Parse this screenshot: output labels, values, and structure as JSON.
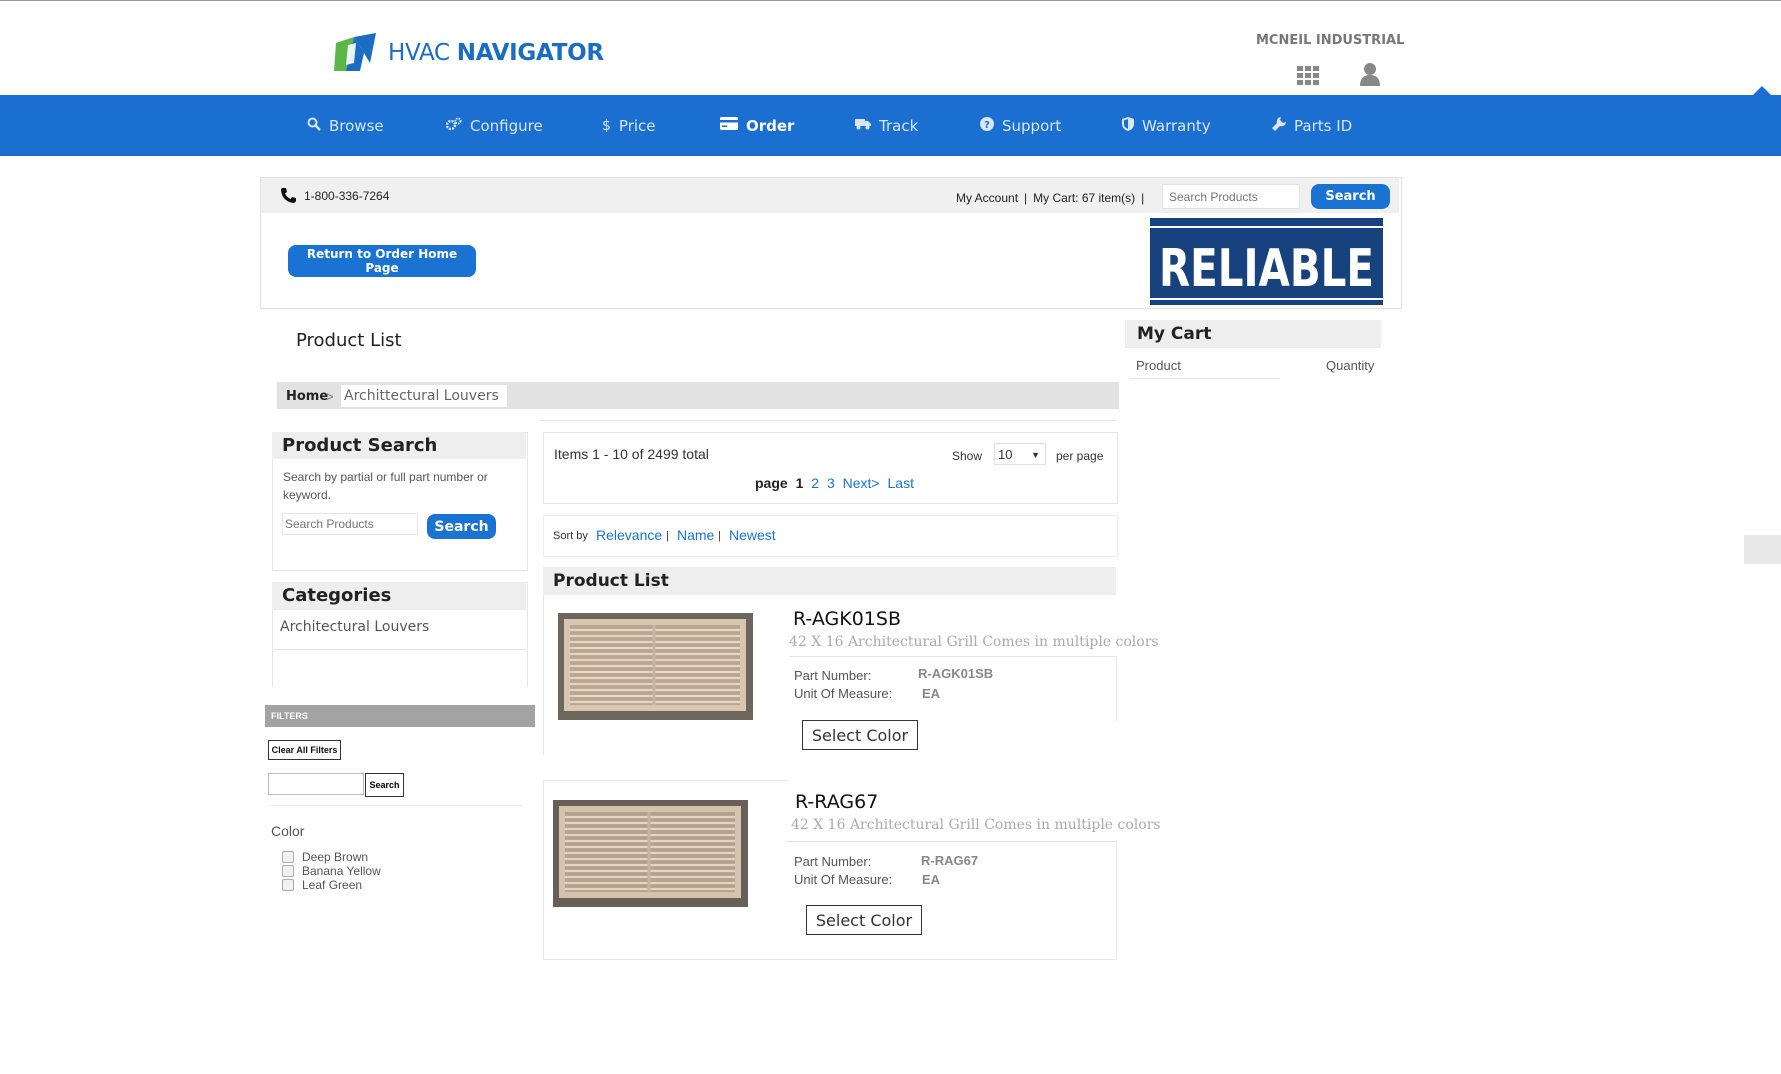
{
  "header": {
    "logo_text_light": "HVAC",
    "logo_text_bold": "NAVIGATOR",
    "company": "MCNEIL INDUSTRIAL",
    "icons": [
      "apps-grid-icon",
      "user-icon"
    ]
  },
  "nav": {
    "items": [
      {
        "label": "Browse",
        "icon": "search-icon"
      },
      {
        "label": "Configure",
        "icon": "gears-icon"
      },
      {
        "label": "Price",
        "icon": "dollar-icon"
      },
      {
        "label": "Order",
        "icon": "credit-card-icon",
        "active": true
      },
      {
        "label": "Track",
        "icon": "truck-icon"
      },
      {
        "label": "Support",
        "icon": "question-icon"
      },
      {
        "label": "Warranty",
        "icon": "shield-icon"
      },
      {
        "label": "Parts ID",
        "icon": "wrench-icon"
      }
    ],
    "color": "#1a6fd0"
  },
  "topbar": {
    "phone": "1-800-336-7264",
    "my_account": "My Account",
    "my_cart": "My Cart: 67 item(s)",
    "search_placeholder": "Search Products",
    "search_button": "Search"
  },
  "return_button": "Return to Order Home Page",
  "brand_logo": "RELIABLE",
  "page_title": "Product List",
  "breadcrumb": {
    "home": "Home",
    "sep": ">",
    "current": "Archittectural Louvers"
  },
  "product_search": {
    "title": "Product Search",
    "description": "Search by partial or full part number or keyword.",
    "placeholder": "Search Products",
    "button": "Search"
  },
  "categories": {
    "title": "Categories",
    "items": [
      "Architectural Louvers"
    ]
  },
  "filters": {
    "title": "FILTERS",
    "clear_button": "Clear All Filters",
    "search_button": "Search",
    "color_label": "Color",
    "colors": [
      "Deep Brown",
      "Banana Yellow",
      "Leaf Green"
    ]
  },
  "listing": {
    "items_text": "Items 1 - 10 of 2499 total",
    "show_label": "Show",
    "show_value": "10",
    "per_page": "per page",
    "page_label": "page",
    "pages": [
      "1",
      "2",
      "3"
    ],
    "next": "Next>",
    "last": "Last",
    "sort_label": "Sort by",
    "sort_options": [
      "Relevance",
      "Name",
      "Newest"
    ],
    "sort_sep": "|",
    "header": "Product List"
  },
  "products": [
    {
      "name": "R-AGK01SB",
      "description": "42 X 16 Architectural Grill Comes in multiple colors",
      "part_number_label": "Part Number:",
      "part_number": "R-AGK01SB",
      "uom_label": "Unit Of Measure:",
      "uom": "EA",
      "button": "Select Color"
    },
    {
      "name": "R-RAG67",
      "description": "42 X 16 Architectural Grill Comes in multiple colors",
      "part_number_label": "Part Number:",
      "part_number": "R-RAG67",
      "uom_label": "Unit Of Measure:",
      "uom": "EA",
      "button": "Select Color"
    }
  ],
  "cart": {
    "title": "My Cart",
    "col_product": "Product",
    "col_quantity": "Quantity"
  }
}
